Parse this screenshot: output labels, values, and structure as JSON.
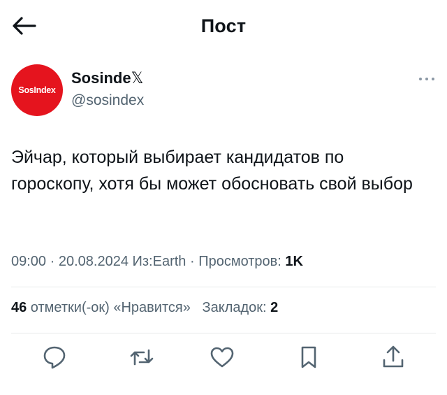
{
  "header": {
    "back_icon": "arrow-left-icon",
    "title": "Пост"
  },
  "author": {
    "avatar_text": "SosIndex",
    "avatar_color": "#e5141e",
    "display_name": "Sosinde",
    "display_name_suffix": "𝕏",
    "handle": "@sosindex"
  },
  "more_icon": "more-dots-icon",
  "tweet": {
    "text": "Эйчар, который выбирает кандидатов по гороскопу, хотя бы может обосновать свой выбор"
  },
  "meta": {
    "time": "09:00",
    "sep1": " · ",
    "date": "20.08.2024",
    "source": " Из:Earth",
    "sep2": " · ",
    "views_label": "Просмотров: ",
    "views_value": "1K"
  },
  "stats": {
    "likes_count": "46",
    "likes_label": " отметки(-ок) «Нравится»",
    "gap": "   ",
    "bookmarks_label": "Закладок: ",
    "bookmarks_count": "2"
  },
  "actions": [
    {
      "icon": "reply-icon"
    },
    {
      "icon": "retweet-icon"
    },
    {
      "icon": "like-icon"
    },
    {
      "icon": "bookmark-icon"
    },
    {
      "icon": "share-icon"
    }
  ],
  "colors": {
    "text": "#0f1419",
    "secondary": "#536471",
    "divider": "#e7e9ea",
    "brand_red": "#e5141e"
  }
}
